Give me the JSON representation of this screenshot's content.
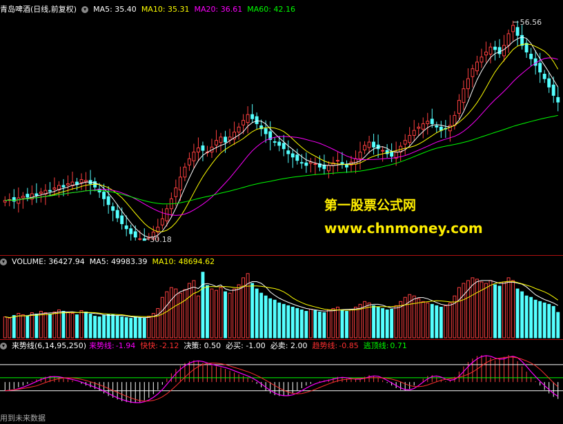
{
  "header_main": {
    "stock": "青岛啤酒(日线,前复权)",
    "ma5": "MA5: 35.40",
    "ma10": "MA10: 35.31",
    "ma20": "MA20: 36.61",
    "ma60": "MA60: 42.16"
  },
  "header_volume": {
    "label": "VOLUME: 36427.94",
    "ma5": "MA5: 49983.39",
    "ma10": "MA10: 48694.62"
  },
  "header_indicator": {
    "name": "来势线(6,14,95,250)",
    "trend_label": "来势线:",
    "trend_val": "-1.94",
    "fast_label": "快快:",
    "fast_val": "-2.12",
    "decide": "决策: 0.50",
    "buy": "必买: -1.00",
    "sell": "必卖: 2.00",
    "momentum_label": "趋势线:",
    "momentum_val": "-0.85",
    "top_label": "逃顶线:",
    "top_val": "0.71"
  },
  "annotations": {
    "high": "56.56",
    "low": "30.18"
  },
  "watermark": {
    "line1": "第一股票公式网",
    "line2": "www.chnmoney.com"
  },
  "footer": "用到未来数据",
  "colors": {
    "up": "#ff4040",
    "down": "#54ffff",
    "ma5": "#ffffff",
    "ma10": "#ffff00",
    "ma20": "#ff00ff",
    "ma60": "#00ff00"
  },
  "chart_data": {
    "type": "candlestick",
    "price_range": [
      30.18,
      56.56
    ],
    "low_point": 30.18,
    "high_point": 56.56,
    "ma_last": {
      "MA5": 35.4,
      "MA10": 35.31,
      "MA20": 36.61,
      "MA60": 42.16
    },
    "volume_last": 36427.94,
    "volume_ma_last": {
      "MA5": 49983.39,
      "MA10": 48694.62
    },
    "close": [
      35.0,
      35.1,
      34.9,
      35.3,
      35.5,
      35.4,
      35.8,
      35.6,
      36.0,
      36.2,
      36.1,
      36.5,
      36.8,
      36.6,
      37.0,
      37.2,
      36.9,
      37.5,
      37.4,
      37.0,
      36.6,
      36.0,
      35.2,
      34.5,
      33.8,
      32.9,
      32.2,
      31.6,
      31.0,
      30.6,
      30.4,
      30.2,
      30.6,
      31.2,
      31.8,
      32.8,
      34.0,
      35.2,
      36.5,
      37.8,
      39.0,
      40.0,
      40.8,
      41.3,
      41.0,
      40.8,
      41.4,
      42.2,
      42.6,
      42.0,
      42.6,
      43.2,
      43.8,
      44.6,
      45.3,
      44.8,
      44.2,
      43.6,
      43.0,
      42.3,
      42.0,
      41.6,
      41.2,
      40.6,
      40.2,
      39.8,
      39.5,
      39.2,
      39.6,
      39.4,
      39.0,
      38.8,
      39.2,
      39.5,
      39.8,
      39.3,
      39.0,
      39.6,
      40.0,
      40.8,
      41.6,
      42.0,
      41.4,
      41.2,
      41.0,
      40.6,
      40.3,
      40.8,
      41.5,
      42.2,
      42.8,
      43.4,
      43.8,
      44.2,
      44.5,
      44.2,
      43.8,
      43.4,
      43.6,
      44.0,
      45.2,
      47.0,
      48.4,
      49.6,
      50.8,
      51.6,
      52.2,
      52.8,
      53.4,
      53.1,
      52.6,
      53.6,
      55.0,
      56.0,
      54.8,
      53.6,
      52.8,
      52.0,
      51.2,
      50.4,
      49.6,
      48.6,
      47.6,
      46.8
    ],
    "volume": [
      30000,
      28000,
      32000,
      35000,
      33000,
      31000,
      36000,
      34000,
      38000,
      36000,
      34000,
      37000,
      40000,
      38000,
      36000,
      35000,
      33000,
      39000,
      37000,
      34000,
      31000,
      30000,
      32000,
      34000,
      33000,
      31000,
      30000,
      29000,
      28000,
      30000,
      29000,
      28000,
      31000,
      35000,
      42000,
      58000,
      66000,
      72000,
      70000,
      64000,
      69000,
      78000,
      82000,
      60000,
      94000,
      75000,
      70000,
      68000,
      72000,
      66000,
      64000,
      70000,
      76000,
      86000,
      92000,
      78000,
      70000,
      64000,
      60000,
      56000,
      54000,
      50000,
      48000,
      46000,
      44000,
      42000,
      40000,
      38000,
      41000,
      39000,
      37000,
      36000,
      40000,
      42000,
      44000,
      40000,
      38000,
      41000,
      44000,
      48000,
      52000,
      50000,
      46000,
      44000,
      42000,
      40000,
      41000,
      46000,
      52000,
      58000,
      62000,
      60000,
      56000,
      52000,
      50000,
      48000,
      46000,
      44000,
      46000,
      50000,
      60000,
      72000,
      78000,
      82000,
      86000,
      84000,
      80000,
      78000,
      82000,
      76000,
      74000,
      80000,
      86000,
      82000,
      70000,
      66000,
      60000,
      58000,
      54000,
      52000,
      50000,
      48000,
      45000,
      36427.94
    ],
    "indicator": [
      -1.0,
      -0.9,
      -0.8,
      -0.6,
      -0.4,
      -0.2,
      0.1,
      0.3,
      0.5,
      0.6,
      0.7,
      0.6,
      0.5,
      0.4,
      0.3,
      0.2,
      0.0,
      -0.2,
      -0.4,
      -0.6,
      -0.8,
      -1.0,
      -1.3,
      -1.6,
      -1.8,
      -2.0,
      -2.2,
      -2.3,
      -2.4,
      -2.4,
      -2.3,
      -2.1,
      -1.8,
      -1.4,
      -0.9,
      -0.3,
      0.4,
      1.0,
      1.5,
      1.9,
      2.2,
      2.4,
      2.5,
      2.4,
      2.2,
      2.0,
      1.9,
      1.8,
      1.7,
      1.5,
      1.3,
      1.1,
      0.9,
      0.7,
      0.5,
      0.2,
      -0.2,
      -0.6,
      -1.0,
      -1.3,
      -1.5,
      -1.6,
      -1.6,
      -1.5,
      -1.3,
      -1.0,
      -0.7,
      -0.4,
      -0.2,
      0.0,
      0.1,
      0.2,
      0.3,
      0.5,
      0.6,
      0.5,
      0.4,
      0.3,
      0.3,
      0.4,
      0.6,
      0.8,
      0.7,
      0.5,
      0.2,
      -0.1,
      -0.4,
      -0.7,
      -0.9,
      -1.0,
      -0.8,
      -0.4,
      0.0,
      0.4,
      0.7,
      0.8,
      0.6,
      0.3,
      0.1,
      0.2,
      0.6,
      1.2,
      1.8,
      2.3,
      2.7,
      3.0,
      3.1,
      3.0,
      2.8,
      2.5,
      2.6,
      2.9,
      3.1,
      2.9,
      2.4,
      1.8,
      1.2,
      0.6,
      0.1,
      -0.4,
      -0.9,
      -1.3,
      -1.7,
      -1.94
    ]
  }
}
